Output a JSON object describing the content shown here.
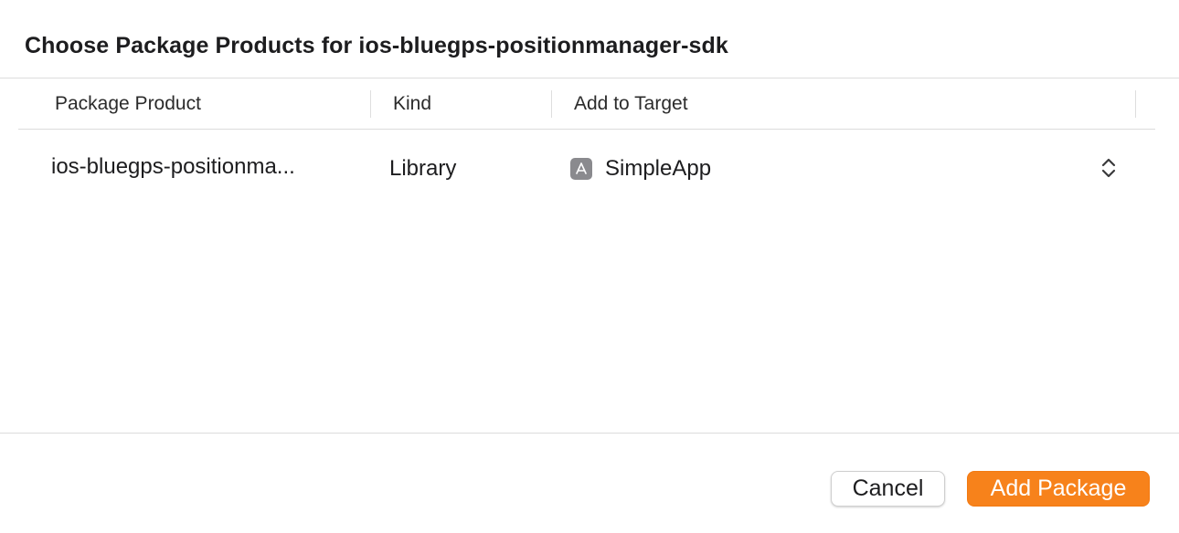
{
  "dialog": {
    "title": "Choose Package Products for ios-bluegps-positionmanager-sdk"
  },
  "table": {
    "columns": [
      "Package Product",
      "Kind",
      "Add to Target"
    ],
    "rows": [
      {
        "product": "ios-bluegps-positionma...",
        "kind": "Library",
        "target": "SimpleApp",
        "target_icon": "app-target-icon"
      }
    ]
  },
  "buttons": {
    "cancel": "Cancel",
    "add": "Add Package"
  },
  "colors": {
    "accent": "#f7821b",
    "icon_bg": "#8a8a8e"
  }
}
